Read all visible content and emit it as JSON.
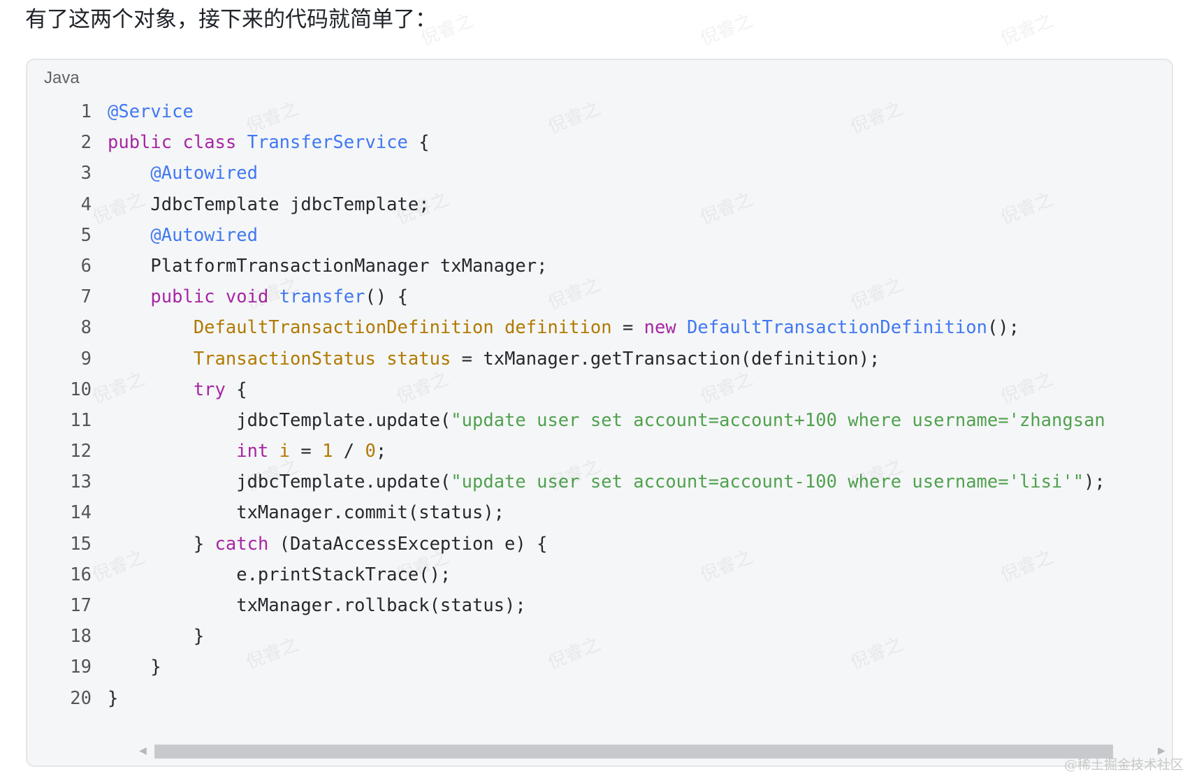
{
  "intro_text": "有了这两个对象，接下来的代码就简单了：",
  "code_block": {
    "language": "Java",
    "lines": [
      {
        "no": "1",
        "tokens": [
          {
            "t": "@Service",
            "c": "an"
          }
        ]
      },
      {
        "no": "2",
        "tokens": [
          {
            "t": "public",
            "c": "kw"
          },
          {
            "t": " "
          },
          {
            "t": "class",
            "c": "kw"
          },
          {
            "t": " "
          },
          {
            "t": "TransferService",
            "c": "fn"
          },
          {
            "t": " {"
          }
        ]
      },
      {
        "no": "3",
        "tokens": [
          {
            "t": "    "
          },
          {
            "t": "@Autowired",
            "c": "an"
          }
        ]
      },
      {
        "no": "4",
        "tokens": [
          {
            "t": "    JdbcTemplate jdbcTemplate;"
          }
        ]
      },
      {
        "no": "5",
        "tokens": [
          {
            "t": "    "
          },
          {
            "t": "@Autowired",
            "c": "an"
          }
        ]
      },
      {
        "no": "6",
        "tokens": [
          {
            "t": "    PlatformTransactionManager txManager;"
          }
        ]
      },
      {
        "no": "7",
        "tokens": [
          {
            "t": "    "
          },
          {
            "t": "public",
            "c": "kw"
          },
          {
            "t": " "
          },
          {
            "t": "void",
            "c": "kw"
          },
          {
            "t": " "
          },
          {
            "t": "transfer",
            "c": "fn"
          },
          {
            "t": "() {"
          }
        ]
      },
      {
        "no": "8",
        "tokens": [
          {
            "t": "        "
          },
          {
            "t": "DefaultTransactionDefinition",
            "c": "ty"
          },
          {
            "t": " "
          },
          {
            "t": "definition",
            "c": "ty"
          },
          {
            "t": " = "
          },
          {
            "t": "new",
            "c": "kw"
          },
          {
            "t": " "
          },
          {
            "t": "DefaultTransactionDefinition",
            "c": "fn"
          },
          {
            "t": "();"
          }
        ]
      },
      {
        "no": "9",
        "tokens": [
          {
            "t": "        "
          },
          {
            "t": "TransactionStatus",
            "c": "ty"
          },
          {
            "t": " "
          },
          {
            "t": "status",
            "c": "ty"
          },
          {
            "t": " = txManager.getTransaction(definition);"
          }
        ]
      },
      {
        "no": "10",
        "tokens": [
          {
            "t": "        "
          },
          {
            "t": "try",
            "c": "kw"
          },
          {
            "t": " {"
          }
        ]
      },
      {
        "no": "11",
        "tokens": [
          {
            "t": "            jdbcTemplate.update("
          },
          {
            "t": "\"update user set account=account+100 where username='zhangsan",
            "c": "st"
          }
        ]
      },
      {
        "no": "12",
        "tokens": [
          {
            "t": "            "
          },
          {
            "t": "int",
            "c": "kw"
          },
          {
            "t": " "
          },
          {
            "t": "i",
            "c": "ty"
          },
          {
            "t": " = "
          },
          {
            "t": "1",
            "c": "nm"
          },
          {
            "t": " / "
          },
          {
            "t": "0",
            "c": "nm"
          },
          {
            "t": ";"
          }
        ]
      },
      {
        "no": "13",
        "tokens": [
          {
            "t": "            jdbcTemplate.update("
          },
          {
            "t": "\"update user set account=account-100 where username='lisi'\"",
            "c": "st"
          },
          {
            "t": ");"
          }
        ]
      },
      {
        "no": "14",
        "tokens": [
          {
            "t": "            txManager.commit(status);"
          }
        ]
      },
      {
        "no": "15",
        "tokens": [
          {
            "t": "        } "
          },
          {
            "t": "catch",
            "c": "kw"
          },
          {
            "t": " (DataAccessException e) {"
          }
        ]
      },
      {
        "no": "16",
        "tokens": [
          {
            "t": "            e.printStackTrace();"
          }
        ]
      },
      {
        "no": "17",
        "tokens": [
          {
            "t": "            txManager.rollback(status);"
          }
        ]
      },
      {
        "no": "18",
        "tokens": [
          {
            "t": "        }"
          }
        ]
      },
      {
        "no": "19",
        "tokens": [
          {
            "t": "    }"
          }
        ]
      },
      {
        "no": "20",
        "tokens": [
          {
            "t": "}"
          }
        ]
      }
    ]
  },
  "scrollbar": {
    "left_arrow": "◀",
    "right_arrow": "▶"
  },
  "watermark_text": "倪睿之",
  "footer_watermark": "@稀土掘金技术社区",
  "colors": {
    "keyword": "#a626a4",
    "annotation": "#4078f2",
    "type": "#b07a00",
    "string": "#50a14f",
    "plain": "#24292e",
    "background": "#f5f6f7"
  }
}
